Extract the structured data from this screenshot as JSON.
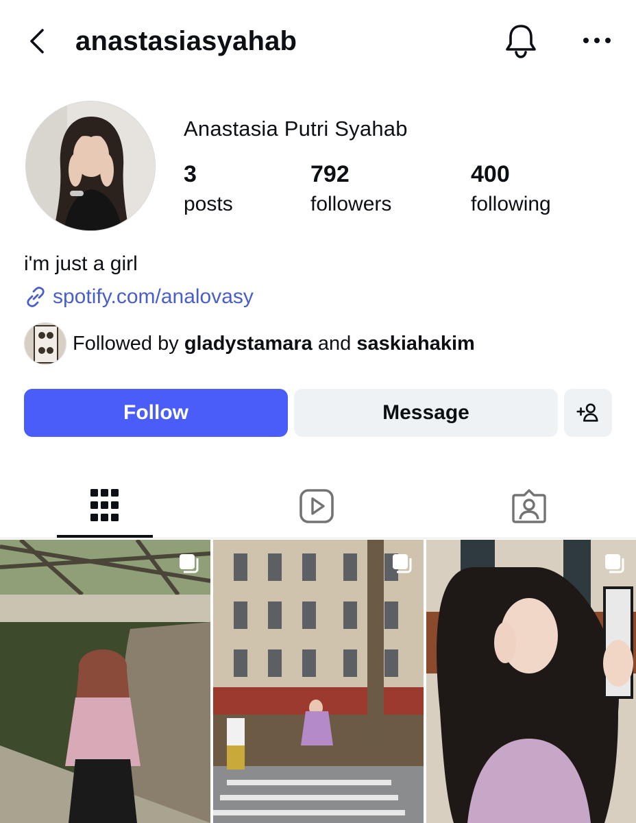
{
  "header": {
    "username": "anastasiasyahab"
  },
  "profile": {
    "full_name": "Anastasia Putri Syahab",
    "stats": [
      {
        "value": "3",
        "label": "posts"
      },
      {
        "value": "792",
        "label": "followers"
      },
      {
        "value": "400",
        "label": "following"
      }
    ],
    "bio": "i'm just a girl",
    "link": "spotify.com/analovasy",
    "followed_by": {
      "prefix": "Followed by ",
      "user1": "gladystamara",
      "middle": " and ",
      "user2": "saskiahakim"
    }
  },
  "actions": {
    "follow_label": "Follow",
    "message_label": "Message"
  },
  "tabs": [
    "grid-icon",
    "reels-icon",
    "tagged-icon"
  ],
  "colors": {
    "accent": "#4a5df9",
    "link": "#4a5ec9",
    "button_bg": "#eff2f5"
  }
}
